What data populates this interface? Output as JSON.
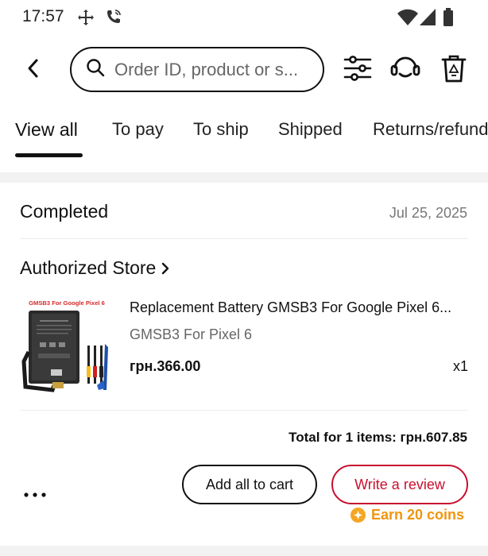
{
  "status_bar": {
    "time": "17:57",
    "icons": [
      "move-icon",
      "wifi-call-icon",
      "wifi-icon",
      "signal-icon",
      "battery-icon"
    ]
  },
  "header": {
    "search": {
      "placeholder": "Order ID, product or s...",
      "value": ""
    },
    "icons": [
      "back-arrow-icon",
      "search-icon",
      "filter-sliders-icon",
      "customer-service-icon",
      "recycle-bin-icon"
    ]
  },
  "tabs": [
    {
      "label": "View all",
      "active": true
    },
    {
      "label": "To pay",
      "active": false
    },
    {
      "label": "To ship",
      "active": false
    },
    {
      "label": "Shipped",
      "active": false
    },
    {
      "label": "Returns/refunds",
      "active": false
    }
  ],
  "order": {
    "status": "Completed",
    "date": "Jul 25, 2025",
    "store_name": "Authorized Store",
    "product": {
      "image_caption": "GMSB3 For Google Pixel 6",
      "title": "Replacement Battery GMSB3 For Google Pixel 6...",
      "variant": "GMSB3 For Pixel 6",
      "price": "грн.366.00",
      "quantity": "x1"
    },
    "total": "Total for 1 items: грн.607.85",
    "actions": {
      "add_to_cart": "Add all to cart",
      "write_review": "Write a review",
      "coins": "Earn 20 coins"
    }
  },
  "colors": {
    "review_red": "#c8102e",
    "coin_orange": "#f0950e",
    "band_gray": "#f2f2f2"
  }
}
